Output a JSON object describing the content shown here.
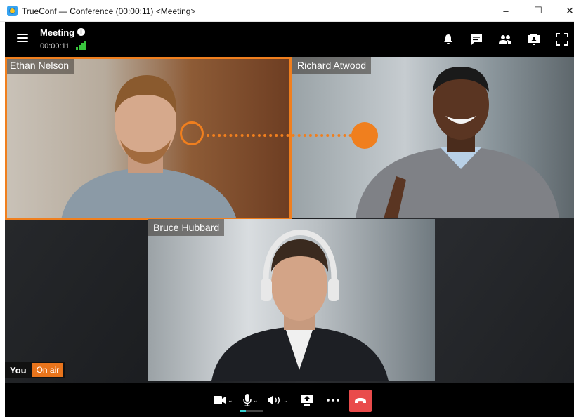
{
  "window": {
    "title": "TrueConf — Conference (00:00:11) <Meeting>",
    "min": "–",
    "max": "☐",
    "close": "✕"
  },
  "header": {
    "title": "Meeting",
    "timer": "00:00:11",
    "info_glyph": "i"
  },
  "participants": [
    {
      "name": "Ethan Nelson",
      "speaking": true
    },
    {
      "name": "Richard Atwood",
      "speaking": false
    },
    {
      "name": "Bruce Hubbard",
      "speaking": false
    }
  ],
  "self": {
    "label": "You",
    "status": "On air"
  },
  "toolbar_icons": [
    "bell-icon",
    "chat-icon",
    "participants-icon",
    "content-share-icon",
    "fullscreen-icon"
  ],
  "controls": [
    "camera-icon",
    "microphone-icon",
    "speaker-icon",
    "share-screen-icon",
    "more-icon",
    "hang-up-icon"
  ],
  "colors": {
    "accent": "#f07f1e",
    "signal": "#39c53d",
    "hangup": "#e94b4b",
    "onair": "#e8741c"
  }
}
